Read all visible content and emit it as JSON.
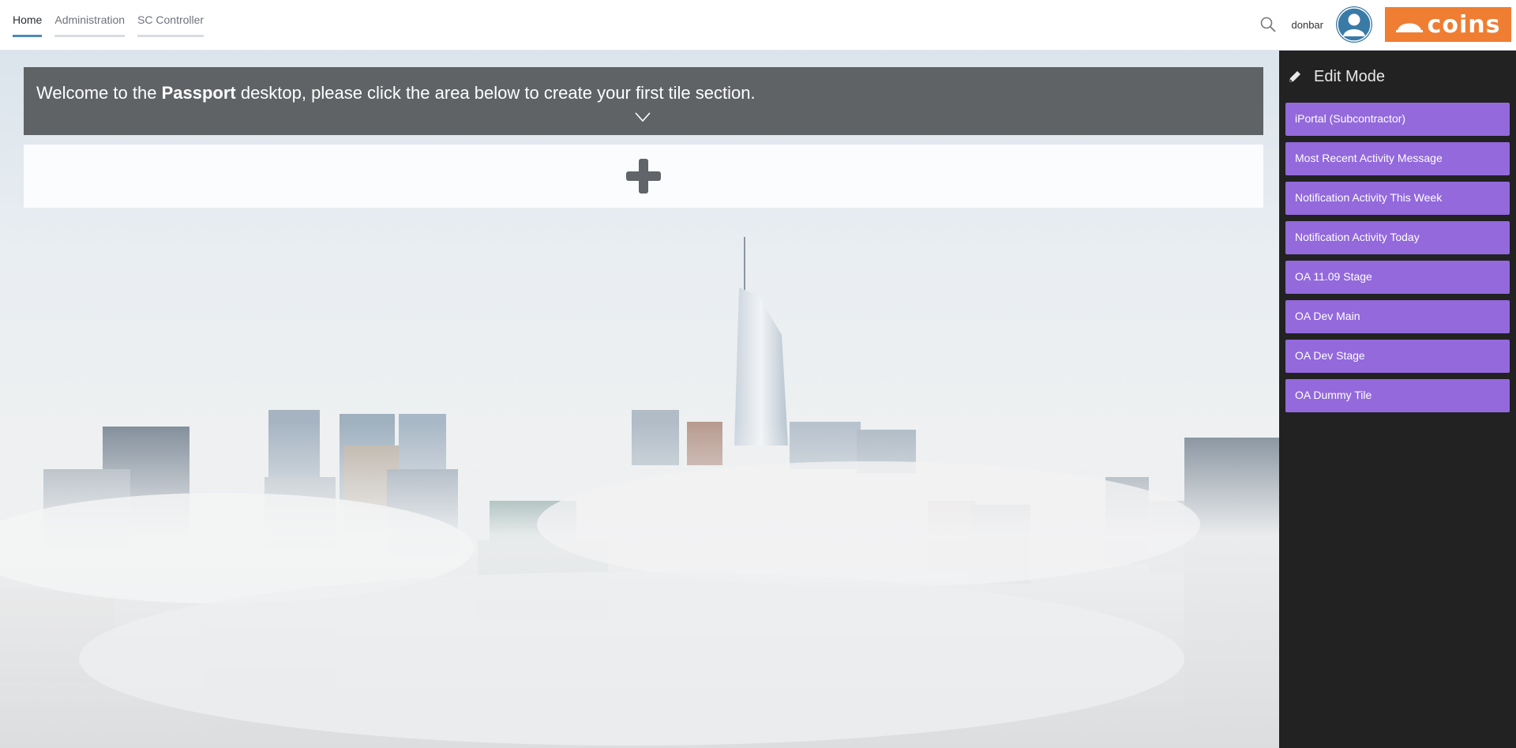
{
  "nav": {
    "tabs": [
      {
        "label": "Home",
        "active": true
      },
      {
        "label": "Administration",
        "active": false
      },
      {
        "label": "SC Controller",
        "active": false
      }
    ]
  },
  "header": {
    "search_icon": "search-icon",
    "username": "donbar",
    "avatar_icon": "user-avatar-icon",
    "logo_text": "coins",
    "logo_color": "#ef7d32"
  },
  "welcome": {
    "prefix": "Welcome to the ",
    "brand": "Passport",
    "suffix": " desktop, please click the area below to create your first tile section."
  },
  "add_section": {
    "icon": "plus-icon"
  },
  "sidebar": {
    "title": "Edit Mode",
    "icon": "pencil-icon",
    "tile_color": "#9369dc",
    "tiles": [
      "iPortal (Subcontractor)",
      "Most Recent Activity Message",
      "Notification Activity This Week",
      "Notification Activity Today",
      "OA 11.09 Stage",
      "OA Dev Main",
      "OA Dev Stage",
      "OA Dummy Tile"
    ]
  }
}
